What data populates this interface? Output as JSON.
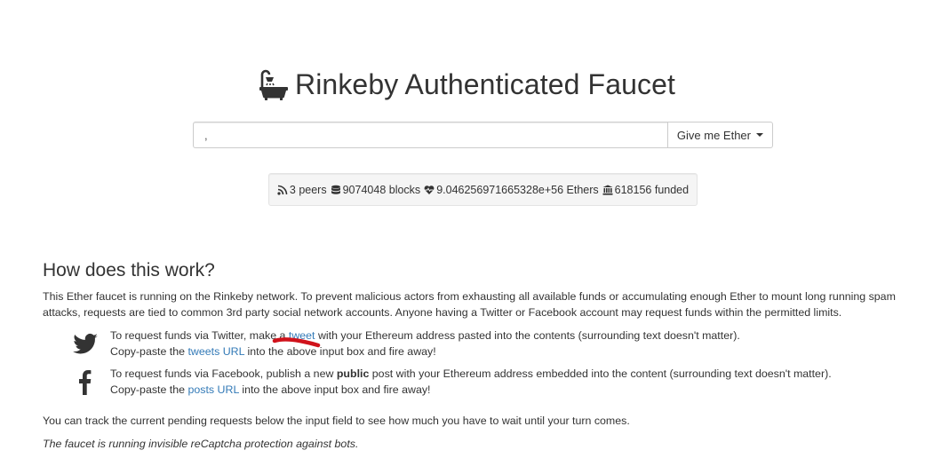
{
  "header": {
    "title": "Rinkeby Authenticated Faucet",
    "icon": "bathtub-icon"
  },
  "request": {
    "input_value": ",",
    "button_label": "Give me Ether"
  },
  "stats": {
    "peers": "3 peers",
    "blocks": "9074048 blocks",
    "ethers": "9.046256971665328e+56 Ethers",
    "funded": "618156 funded"
  },
  "info": {
    "heading": "How does this work?",
    "intro": "This Ether faucet is running on the Rinkeby network. To prevent malicious actors from exhausting all available funds or accumulating enough Ether to mount long running spam attacks, requests are tied to common 3rd party social network accounts. Anyone having a Twitter or Facebook account may request funds within the permitted limits.",
    "twitter": {
      "line1_before": "To request funds via Twitter, make a ",
      "line1_link": "tweet",
      "line1_after": " with your Ethereum address pasted into the contents (surrounding text doesn't matter).",
      "line2_before": "Copy-paste the ",
      "line2_link": "tweets URL",
      "line2_after": " into the above input box and fire away!"
    },
    "facebook": {
      "line1_before": "To request funds via Facebook, publish a new ",
      "line1_bold": "public",
      "line1_after": " post with your Ethereum address embedded into the content (surrounding text doesn't matter).",
      "line2_before": "Copy-paste the ",
      "line2_link": "posts URL",
      "line2_after": " into the above input box and fire away!"
    },
    "tracking": "You can track the current pending requests below the input field to see how much you have to wait until your turn comes.",
    "captcha": "The faucet is running invisible reCaptcha protection against bots."
  },
  "colors": {
    "link": "#337ab7",
    "text": "#333333",
    "annotation": "#d0121b"
  }
}
